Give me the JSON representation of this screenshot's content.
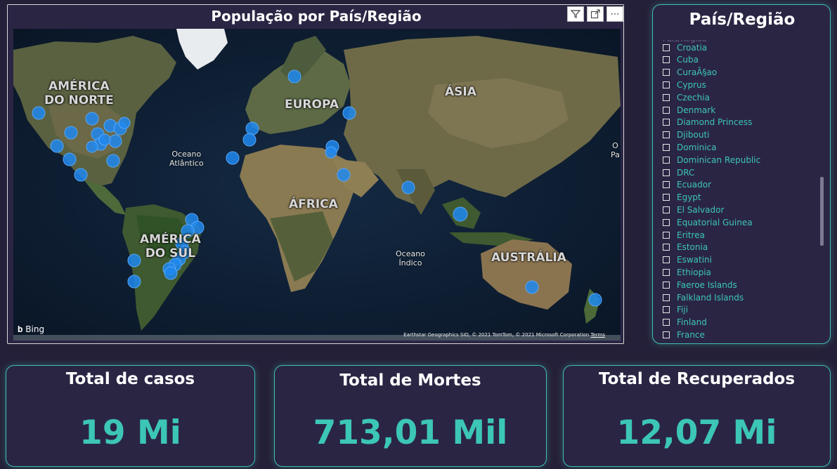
{
  "map": {
    "title": "População por País/Região",
    "labels": {
      "north_america": "AMÉRICA\nDO NORTE",
      "europe": "EUROPA",
      "asia": "ÁSIA",
      "africa": "ÁFRICA",
      "south_america": "AMÉRICA\nDO SUL",
      "australia": "AUSTRÁLIA",
      "atlantic": "Oceano\nAtlântico",
      "indian": "Oceano\nÍndico",
      "pacific_partial": "O\nPa"
    },
    "bing": "Bing",
    "credit": "Earthstar Geographics SIO, © 2021 TomTom, © 2021 Microsoft Corporation",
    "terms": "Terms",
    "header_icons": [
      "filter-icon",
      "focus-mode-icon",
      "more-options-icon"
    ],
    "bubble_color": "#1e88f0"
  },
  "slicer": {
    "title": "País/Região",
    "partial_top": "País/Região",
    "items": [
      "Croatia",
      "Cuba",
      "CuraÃ§ao",
      "Cyprus",
      "Czechia",
      "Denmark",
      "Diamond Princess",
      "Djibouti",
      "Dominica",
      "Dominican Republic",
      "DRC",
      "Ecuador",
      "Egypt",
      "El Salvador",
      "Equatorial Guinea",
      "Eritrea",
      "Estonia",
      "Eswatini",
      "Ethiopia",
      "Faeroe Islands",
      "Falkland Islands",
      "Fiji",
      "Finland",
      "France"
    ]
  },
  "kpis": [
    {
      "title": "Total de casos",
      "value": "19 Mi"
    },
    {
      "title": "Total de Mortes",
      "value": "713,01 Mil"
    },
    {
      "title": "Total de Recuperados",
      "value": "12,07 Mi"
    }
  ],
  "colors": {
    "accent": "#3cc6b6",
    "background": "#252039",
    "card": "#2b2544"
  }
}
